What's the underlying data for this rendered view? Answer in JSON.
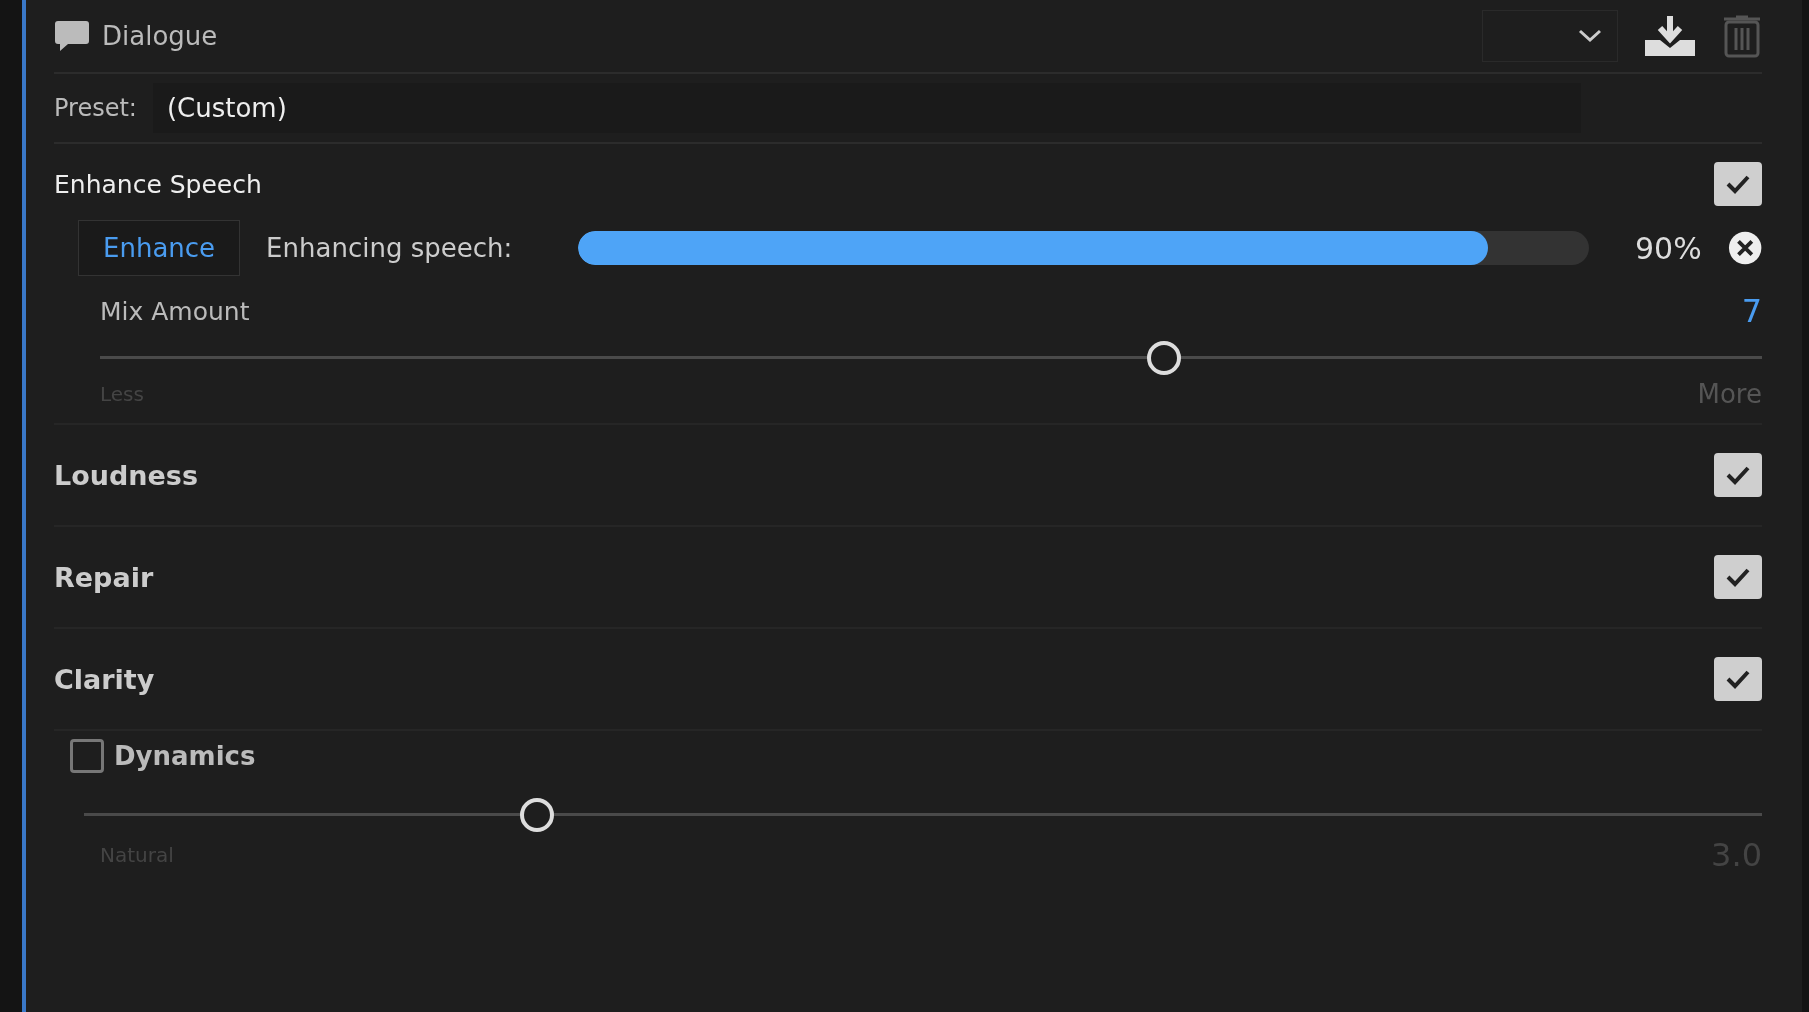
{
  "header": {
    "title": "Dialogue"
  },
  "preset": {
    "label": "Preset:",
    "value": "(Custom)"
  },
  "enhance_speech": {
    "title": "Enhance Speech",
    "checked": true,
    "button": "Enhance",
    "status_label": "Enhancing speech:",
    "level": 0.9,
    "reading": "90%",
    "mix": {
      "label": "Mix Amount",
      "value": "7",
      "level": 0.64,
      "min_label": "Less",
      "max_label": "More"
    }
  },
  "sections": [
    {
      "title": "Loudness",
      "checked": true
    },
    {
      "title": "Repair",
      "checked": true
    },
    {
      "title": "Clarity",
      "checked": true
    }
  ],
  "dynamics": {
    "label": "Dynamics",
    "checked": false,
    "level": 0.27,
    "min_label": "Natural",
    "value": "3.0"
  }
}
